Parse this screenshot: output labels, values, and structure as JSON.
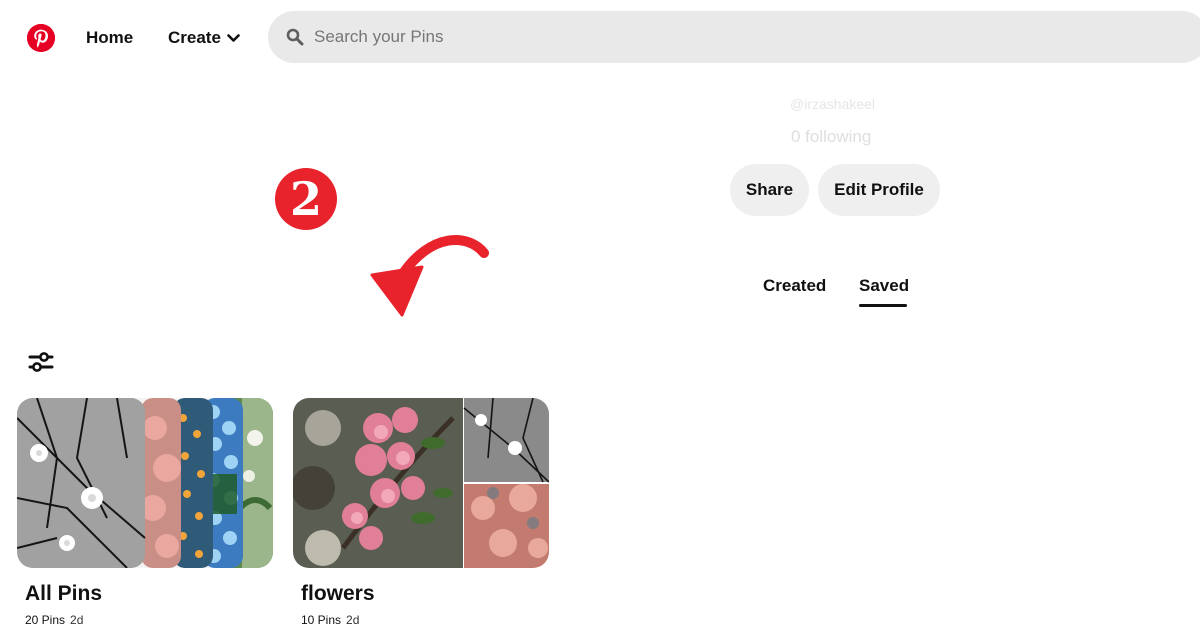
{
  "header": {
    "home_label": "Home",
    "create_label": "Create",
    "search_placeholder": "Search your Pins"
  },
  "profile": {
    "username": "@irzashakeel",
    "following": "0 following",
    "share_label": "Share",
    "edit_label": "Edit Profile"
  },
  "tabs": [
    {
      "label": "Created",
      "active": false
    },
    {
      "label": "Saved",
      "active": true
    }
  ],
  "annotation": {
    "step_number": "2",
    "color": "#e8232b"
  },
  "boards": [
    {
      "title": "All Pins",
      "pins": "20 Pins",
      "updated": "2d"
    },
    {
      "title": "flowers",
      "pins": "10 Pins",
      "updated": "2d"
    }
  ],
  "colors": {
    "brand": "#e60023",
    "pill_bg": "#efefef",
    "search_bg": "#e9e9e9"
  }
}
